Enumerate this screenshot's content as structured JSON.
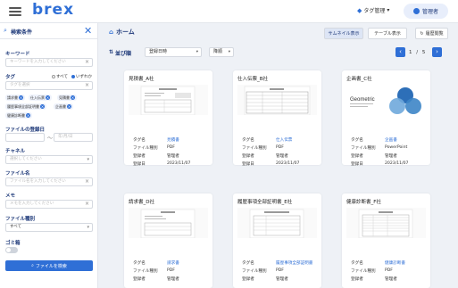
{
  "header": {
    "logo": "brex",
    "tag_manage": "タグ管理",
    "admin": "管理者"
  },
  "sidebar": {
    "title": "検索条件",
    "keyword_label": "キーワード",
    "keyword_placeholder": "キーワードを入力してください",
    "tag_label": "タグ",
    "tag_radio_all": "すべて",
    "tag_radio_any": "いずれか",
    "tag_placeholder": "タグを選択",
    "tags": [
      "請求書",
      "仕入伝票",
      "見積書",
      "履歴事項全部証明書",
      "企画書",
      "健康診断書"
    ],
    "date_label": "ファイルの登録日",
    "date_from": "",
    "date_sep": "～",
    "date_to": "年/月/日",
    "channel_label": "チャネル",
    "channel_placeholder": "選択してください",
    "filename_label": "ファイル名",
    "filename_placeholder": "ファイル名を入力してください",
    "memo_label": "メモ",
    "memo_placeholder": "メモを入力してください",
    "filetype_label": "ファイル種別",
    "filetype_value": "すべて",
    "trash_label": "ゴミ箱",
    "search_button": "ファイルを検索"
  },
  "main": {
    "breadcrumb": "ホーム",
    "view_thumbnail": "サムネイル表示",
    "view_table": "テーブル表示",
    "history": "履歴閲覧",
    "sort_label": "並び順",
    "sort_key": "登録日時",
    "sort_order": "降順",
    "page_current": "1",
    "page_sep": "/",
    "page_total": "5",
    "field_labels": {
      "tag": "タグ名",
      "type": "ファイル種別",
      "registrant": "登録者",
      "date": "登録日"
    },
    "cards": [
      {
        "title": "見積書_A社",
        "tag": "見積書",
        "type": "PDF",
        "registrant": "管理者",
        "date": "2023/11/07"
      },
      {
        "title": "仕入伝票_B社",
        "tag": "仕入伝票",
        "type": "PDF",
        "registrant": "管理者",
        "date": "2023/11/07"
      },
      {
        "title": "企画書_C社",
        "tag": "企画書",
        "type": "PowerPoint",
        "registrant": "管理者",
        "date": "2023/11/07"
      },
      {
        "title": "請求書_D社",
        "tag": "請求書",
        "type": "PDF",
        "registrant": "管理者",
        "date": ""
      },
      {
        "title": "履歴事項全部証明書_E社",
        "tag": "履歴事項全部証明書",
        "type": "PDF",
        "registrant": "管理者",
        "date": ""
      },
      {
        "title": "健康診断書_F社",
        "tag": "健康診断書",
        "type": "PDF",
        "registrant": "管理者",
        "date": ""
      }
    ],
    "thumb_c_text": "Geometric"
  }
}
